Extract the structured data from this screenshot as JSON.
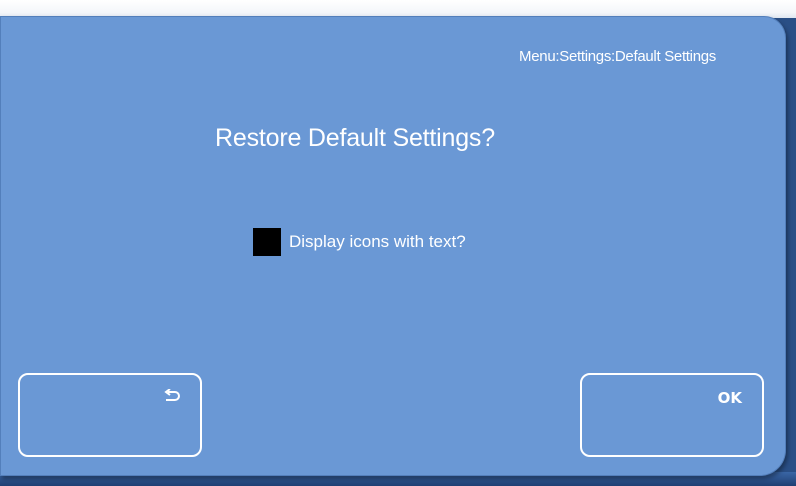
{
  "screen": {
    "breadcrumb": "Menu:Settings:Default Settings",
    "title": "Restore Default Settings?"
  },
  "option": {
    "label": "Display icons with text?",
    "checked": true
  },
  "buttons": {
    "back_icon": "return-arrow-icon",
    "ok_label": "OK"
  },
  "colors": {
    "panel": "#6a98d5",
    "frame": "#2a4f86",
    "text": "#ffffff",
    "checkbox_fill": "#000000"
  }
}
